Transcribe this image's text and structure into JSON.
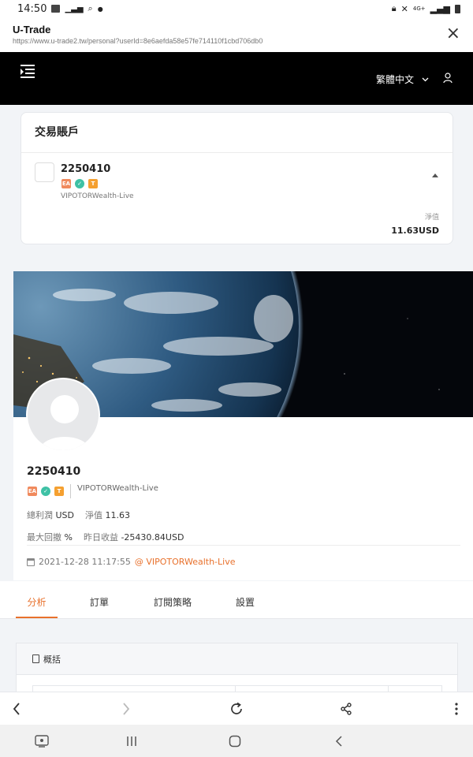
{
  "status_bar": {
    "time": "14:50",
    "network": "4G+"
  },
  "browser": {
    "title": "U-Trade",
    "url": "https://www.u-trade2.tw/personal?userId=8e6aefda58e57fe714110f1cbd706db0"
  },
  "header": {
    "language": "繁體中文"
  },
  "account_card": {
    "title": "交易賬戶",
    "account_id": "2250410",
    "badges": [
      "EA",
      "",
      "T"
    ],
    "server": "VIPOTORWealth-Live",
    "equity_label": "淨值",
    "equity_value": "11.63USD"
  },
  "profile": {
    "account_id": "2250410",
    "badges": [
      "EA",
      "",
      "T"
    ],
    "server": "VIPOTORWealth-Live",
    "stats": {
      "total_profit_label": "總利潤",
      "total_profit_value": "USD",
      "equity_label": "淨值",
      "equity_value": "11.63",
      "max_drawdown_label": "最大回撤",
      "max_drawdown_value": "%",
      "yesterday_label": "昨日收益",
      "yesterday_value": "-25430.84USD"
    },
    "date": "2021-12-28 11:17:55",
    "at_server": "@ VIPOTORWealth-Live"
  },
  "tabs": [
    {
      "label": "分析",
      "active": true
    },
    {
      "label": "訂單",
      "active": false
    },
    {
      "label": "訂閱策略",
      "active": false
    },
    {
      "label": "設置",
      "active": false
    }
  ],
  "overview": {
    "title": "概括"
  },
  "colors": {
    "accent": "#e8712c",
    "header_bg": "#000000",
    "badge_ea": "#f08a5d",
    "badge_shield": "#3ec1a5",
    "badge_t": "#f5a030"
  },
  "icons": {
    "menu": "menu-icon",
    "user": "user-icon",
    "close": "close-icon",
    "calendar": "calendar-icon",
    "doc": "document-icon"
  }
}
